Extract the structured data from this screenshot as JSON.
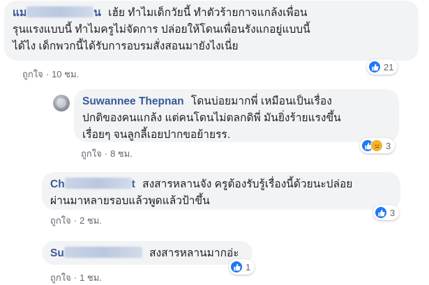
{
  "comments": [
    {
      "name_visible": "แม",
      "name_tail": "น",
      "text_lines": [
        "เฮ้ย ทำไมเด็กวัยนี้ ทำตัวร้ายกาจแกล้งเพื่อน",
        "รุนแรงแบบนี้ ทำไมครูไม่จัดการ ปล่อยให้โดนเพื่อนรังแกอยู่แบบนี้",
        "ได้ไง เด็กพวกนี้ได้รับการอบรมสั่งสอนมายังไงเนี่ย"
      ],
      "like_label": "ถูกใจ",
      "time": "10 ชม.",
      "reaction_count": "21"
    },
    {
      "name": "Suwannee Thepnan",
      "text_first": "โดนบ่อยมากพี่ เหมือนเป็นเรื่อง",
      "text_lines": [
        "ปกติของคนแกล้ง แต่คนโดนไม่ตลกดิพี่ มันยิ่งร้ายแรงขึ้น",
        "เรื่อยๆ จนลูกลี้เอยปากขอย้ายรร."
      ],
      "like_label": "ถูกใจ",
      "time": "8 ชม.",
      "reaction_count": "3"
    },
    {
      "name_visible": "Ch",
      "name_tail": "t",
      "text_first": "สงสารหลานจัง ครูต้องรับรู้เรื่องนี้ด้วยนะปล่อย",
      "text_lines": [
        "ผ่านมาหลายรอบแล้วพูดแล้วป้าขึ้น"
      ],
      "like_label": "ถูกใจ",
      "time": "2 ชม.",
      "reaction_count": "3"
    },
    {
      "name_visible": "Su",
      "text_first": "สงสารหลานมากอ่ะ",
      "like_label": "ถูกใจ",
      "time": "1 ชม.",
      "reaction_count": "1"
    }
  ],
  "separator": "·",
  "colors": {
    "name": "#385898",
    "bubble": "#f2f3f5",
    "like": "#2078f4",
    "sad": "#f7b125"
  }
}
